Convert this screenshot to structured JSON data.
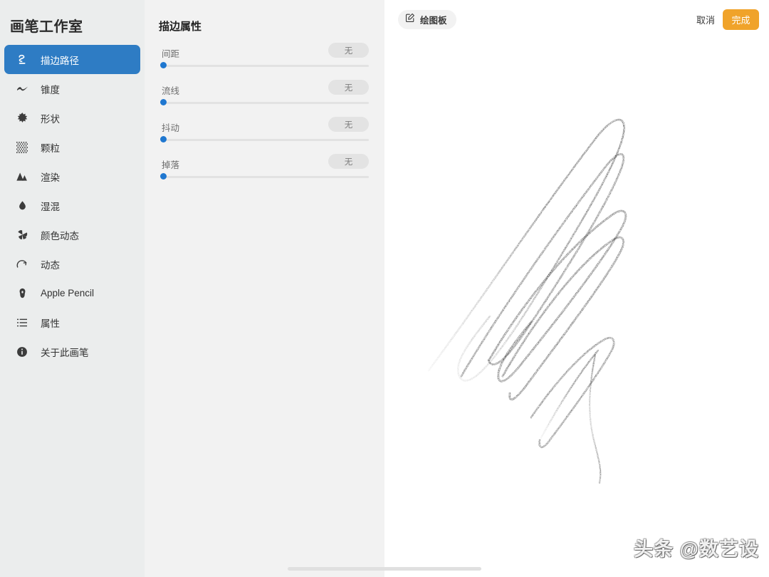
{
  "sidebar": {
    "title": "画笔工作室",
    "items": [
      {
        "label": "描边路径",
        "icon": "stroke-path-icon",
        "active": true
      },
      {
        "label": "锥度",
        "icon": "taper-icon",
        "active": false
      },
      {
        "label": "形状",
        "icon": "shape-starburst-icon",
        "active": false
      },
      {
        "label": "颗粒",
        "icon": "grain-dots-icon",
        "active": false
      },
      {
        "label": "渲染",
        "icon": "render-mountains-icon",
        "active": false
      },
      {
        "label": "湿混",
        "icon": "wet-mix-droplet-icon",
        "active": false
      },
      {
        "label": "颜色动态",
        "icon": "color-dynamics-pinwheel-icon",
        "active": false
      },
      {
        "label": "动态",
        "icon": "dynamics-gauge-icon",
        "active": false
      },
      {
        "label": "Apple Pencil",
        "icon": "apple-pencil-icon",
        "active": false
      },
      {
        "label": "属性",
        "icon": "attributes-list-icon",
        "active": false
      },
      {
        "label": "关于此画笔",
        "icon": "info-circle-icon",
        "active": false
      }
    ]
  },
  "properties_panel": {
    "title": "描边属性",
    "sliders": [
      {
        "label": "间距",
        "value": "无",
        "fill_percent": 0
      },
      {
        "label": "流线",
        "value": "无",
        "fill_percent": 0
      },
      {
        "label": "抖动",
        "value": "无",
        "fill_percent": 0
      },
      {
        "label": "掉落",
        "value": "无",
        "fill_percent": 0
      }
    ]
  },
  "toolbar": {
    "drawpad_label": "绘图板",
    "drawpad_icon": "edit-square-pencil-icon",
    "cancel_label": "取消",
    "done_label": "完成"
  },
  "canvas": {
    "stroke_description": "zigzag-loop-brush-stroke",
    "stroke_color": "#1a1a1a"
  },
  "watermark": {
    "text": "头条 @数艺设"
  },
  "colors": {
    "sidebar_bg": "#ebeded",
    "panel_bg": "#f2f2f2",
    "accent_blue": "#2e7cc4",
    "slider_blue": "#1f77d0",
    "done_orange": "#f0a32a",
    "canvas_bg": "#ffffff"
  }
}
